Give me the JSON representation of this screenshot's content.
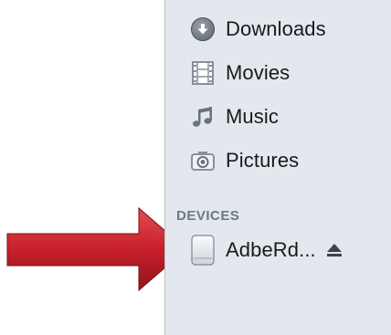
{
  "sidebar": {
    "places": [
      {
        "label": "Downloads",
        "icon": "download-icon"
      },
      {
        "label": "Movies",
        "icon": "film-strip-icon"
      },
      {
        "label": "Music",
        "icon": "music-note-icon"
      },
      {
        "label": "Pictures",
        "icon": "camera-icon"
      }
    ],
    "devices_header": "DEVICES",
    "devices": [
      {
        "label": "AdbeRd...",
        "icon": "external-drive-icon",
        "eject_icon": "eject-icon"
      }
    ]
  },
  "annotation": {
    "arrow_color": "#c8202a"
  }
}
